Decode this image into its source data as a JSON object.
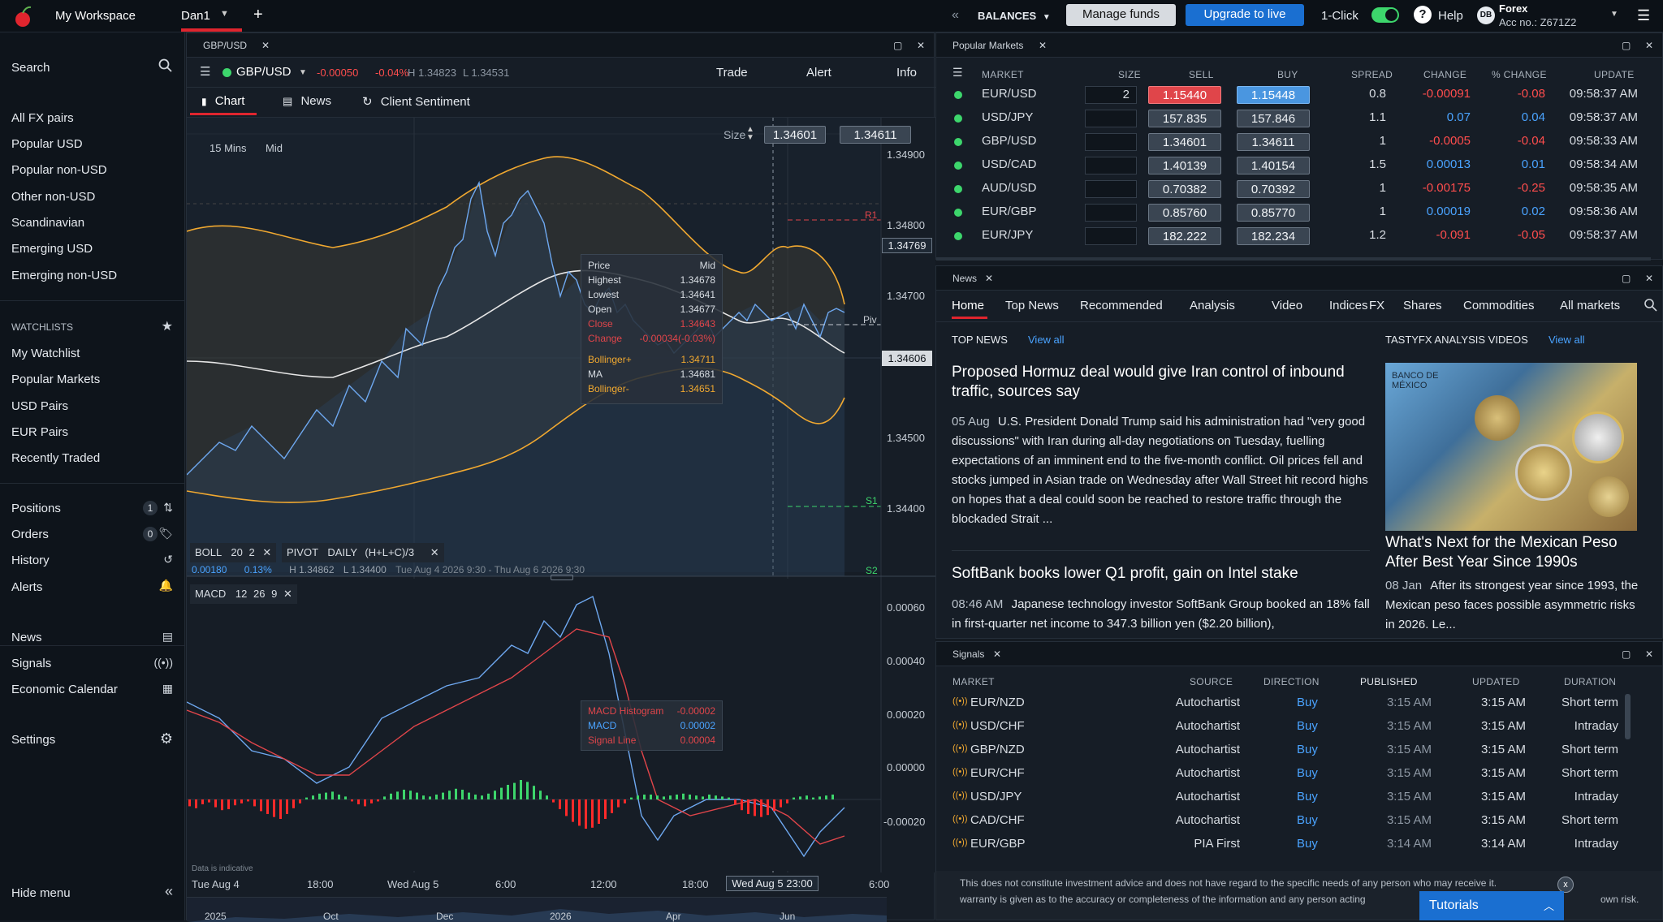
{
  "topbar": {
    "workspace": "My Workspace",
    "tab": "Dan1",
    "add": "+",
    "balances": "BALANCES",
    "manage_funds": "Manage funds",
    "upgrade": "Upgrade to live",
    "one_click": "1-Click",
    "help": "Help",
    "account_type": "Forex",
    "account_no": "Acc no.: Z671Z2",
    "avatar": "DB"
  },
  "sidebar": {
    "search": "Search",
    "pairs": [
      "All FX pairs",
      "Popular USD",
      "Popular non-USD",
      "Other non-USD",
      "Scandinavian",
      "Emerging USD",
      "Emerging non-USD"
    ],
    "watchlists_title": "WATCHLISTS",
    "watchlists": [
      "My Watchlist",
      "Popular Markets",
      "USD Pairs",
      "EUR Pairs",
      "Recently Traded"
    ],
    "positions": "Positions",
    "positions_count": "1",
    "orders": "Orders",
    "orders_count": "0",
    "history": "History",
    "alerts": "Alerts",
    "news": "News",
    "signals": "Signals",
    "economic_calendar": "Economic Calendar",
    "settings": "Settings",
    "hide_menu": "Hide menu"
  },
  "chart_panel": {
    "tab": "GBP/USD",
    "instrument": "GBP/USD",
    "change": "-0.00050",
    "change_pct": "-0.04%",
    "high": "H 1.34823",
    "low": "L 1.34531",
    "trade": "Trade",
    "alert": "Alert",
    "info": "Info",
    "subtabs": [
      "Chart",
      "News",
      "Client Sentiment"
    ],
    "interval": "15 Mins",
    "price_type": "Mid",
    "size_label": "Size",
    "sell": "1.34601",
    "buy": "1.34611",
    "price_axis": [
      "1.34900",
      "1.34800",
      "1.34769",
      "1.34700",
      "1.34606",
      "1.34500",
      "1.34400"
    ],
    "levels": {
      "r1": "R1",
      "piv": "Piv",
      "s1": "S1",
      "s2": "S2"
    },
    "tooltip": {
      "price": "Price",
      "mid": "Mid",
      "rows": [
        [
          "Highest",
          "1.34678"
        ],
        [
          "Lowest",
          "1.34641"
        ],
        [
          "Open",
          "1.34677"
        ],
        [
          "Close",
          "1.34643"
        ],
        [
          "Change",
          "-0.00034(-0.03%)"
        ]
      ],
      "bands": [
        [
          "Bollinger+",
          "1.34711"
        ],
        [
          "MA",
          "1.34681"
        ],
        [
          "Bollinger-",
          "1.34651"
        ]
      ]
    },
    "boll": {
      "name": "BOLL",
      "p1": "20",
      "p2": "2",
      "value": "0.00180",
      "pct": "0.13%",
      "high": "H 1.34862",
      "low": "L 1.34400",
      "range": "Tue Aug 4 2026 9:30 - Thu Aug 6 2026 9:30"
    },
    "pivot": {
      "name": "PIVOT",
      "type": "DAILY",
      "formula": "(H+L+C)/3"
    },
    "macd": {
      "name": "MACD",
      "p1": "12",
      "p2": "26",
      "p3": "9",
      "axis": [
        "0.00060",
        "0.00040",
        "0.00020",
        "0.00000",
        "-0.00020"
      ],
      "tooltip": [
        [
          "MACD Histogram",
          "-0.00002"
        ],
        [
          "MACD",
          "0.00002"
        ],
        [
          "Signal Line",
          "0.00004"
        ]
      ]
    },
    "disclaimer": "Data is indicative",
    "time_axis": [
      "Tue Aug 4",
      "18:00",
      "Wed Aug 5",
      "6:00",
      "12:00",
      "18:00",
      "6:00"
    ],
    "crosshair_time": "Wed Aug 5 23:00",
    "nav_axis": [
      "2025",
      "Oct",
      "Dec",
      "2026",
      "Apr",
      "Jun"
    ]
  },
  "popular_markets": {
    "tab": "Popular Markets",
    "headers": [
      "MARKET",
      "SIZE",
      "SELL",
      "BUY",
      "SPREAD",
      "CHANGE",
      "% CHANGE",
      "UPDATE"
    ],
    "rows": [
      {
        "market": "EUR/USD",
        "size": "2",
        "sell": "1.15440",
        "buy": "1.15448",
        "spread": "0.8",
        "change": "-0.00091",
        "pct": "-0.08",
        "time": "09:58:37 AM",
        "dir": "neg",
        "hl": true
      },
      {
        "market": "USD/JPY",
        "size": "",
        "sell": "157.835",
        "buy": "157.846",
        "spread": "1.1",
        "change": "0.07",
        "pct": "0.04",
        "time": "09:58:37 AM",
        "dir": "pos",
        "hl": false
      },
      {
        "market": "GBP/USD",
        "size": "",
        "sell": "1.34601",
        "buy": "1.34611",
        "spread": "1",
        "change": "-0.0005",
        "pct": "-0.04",
        "time": "09:58:33 AM",
        "dir": "neg",
        "hl": false
      },
      {
        "market": "USD/CAD",
        "size": "",
        "sell": "1.40139",
        "buy": "1.40154",
        "spread": "1.5",
        "change": "0.00013",
        "pct": "0.01",
        "time": "09:58:34 AM",
        "dir": "pos",
        "hl": false
      },
      {
        "market": "AUD/USD",
        "size": "",
        "sell": "0.70382",
        "buy": "0.70392",
        "spread": "1",
        "change": "-0.00175",
        "pct": "-0.25",
        "time": "09:58:35 AM",
        "dir": "neg",
        "hl": false
      },
      {
        "market": "EUR/GBP",
        "size": "",
        "sell": "0.85760",
        "buy": "0.85770",
        "spread": "1",
        "change": "0.00019",
        "pct": "0.02",
        "time": "09:58:36 AM",
        "dir": "pos",
        "hl": false
      },
      {
        "market": "EUR/JPY",
        "size": "",
        "sell": "182.222",
        "buy": "182.234",
        "spread": "1.2",
        "change": "-0.091",
        "pct": "-0.05",
        "time": "09:58:37 AM",
        "dir": "neg",
        "hl": false
      }
    ]
  },
  "news": {
    "tab": "News",
    "nav": [
      "Home",
      "Top News",
      "Recommended",
      "Analysis",
      "Video",
      "Indices",
      "FX",
      "Shares",
      "Commodities",
      "All markets"
    ],
    "top_news": "TOP NEWS",
    "view_all": "View all",
    "videos_title": "TASTYFX ANALYSIS VIDEOS",
    "videos_view_all": "View all",
    "story1_title": "Proposed Hormuz deal would give Iran control of inbound traffic, sources say",
    "story1_date": "05 Aug",
    "story1_body": "U.S. President Donald Trump said his administration had \"very good discussions\" with Iran during all-day negotiations on Tuesday, fuelling expectations of an imminent end to the five-month conflict. Oil prices fell and stocks jumped in Asian trade on Wednesday after Wall Street hit record highs on hopes that a deal could soon be reached to restore traffic through the blockaded Strait ...",
    "story2_title": "SoftBank books lower Q1 profit, gain on Intel stake",
    "story2_date": "08:46 AM",
    "story2_body": "Japanese technology investor SoftBank Group booked an 18% fall in first-quarter net income to 347.3 billion yen ($2.20 billion),",
    "video_title": "What's Next for the Mexican Peso After Best Year Since 1990s",
    "video_date": "08 Jan",
    "video_body": "After its strongest year since 1993, the Mexican peso faces possible asymmetric risks in 2026. Le...",
    "banknote_text": "BANCO DE MÉXICO"
  },
  "signals": {
    "tab": "Signals",
    "headers": [
      "MARKET",
      "SOURCE",
      "DIRECTION",
      "PUBLISHED",
      "UPDATED",
      "DURATION"
    ],
    "rows": [
      {
        "market": "EUR/NZD",
        "source": "Autochartist",
        "direction": "Buy",
        "published": "3:15 AM",
        "updated": "3:15 AM",
        "duration": "Short term"
      },
      {
        "market": "USD/CHF",
        "source": "Autochartist",
        "direction": "Buy",
        "published": "3:15 AM",
        "updated": "3:15 AM",
        "duration": "Intraday"
      },
      {
        "market": "GBP/NZD",
        "source": "Autochartist",
        "direction": "Buy",
        "published": "3:15 AM",
        "updated": "3:15 AM",
        "duration": "Short term"
      },
      {
        "market": "EUR/CHF",
        "source": "Autochartist",
        "direction": "Buy",
        "published": "3:15 AM",
        "updated": "3:15 AM",
        "duration": "Short term"
      },
      {
        "market": "USD/JPY",
        "source": "Autochartist",
        "direction": "Buy",
        "published": "3:15 AM",
        "updated": "3:15 AM",
        "duration": "Intraday"
      },
      {
        "market": "CAD/CHF",
        "source": "Autochartist",
        "direction": "Buy",
        "published": "3:15 AM",
        "updated": "3:15 AM",
        "duration": "Short term"
      },
      {
        "market": "EUR/GBP",
        "source": "PIA First",
        "direction": "Buy",
        "published": "3:14 AM",
        "updated": "3:14 AM",
        "duration": "Intraday"
      }
    ],
    "disclaimer_line1": "This does not constitute investment advice and does not have regard to the specific needs of any person who may receive it.",
    "disclaimer_line2": "warranty is given as to the accuracy or completeness of the information and any person acting",
    "disclaimer_tail": "own risk.",
    "tutorials": "Tutorials"
  },
  "colors": {
    "accent_red": "#e0252e",
    "upgrade_blue": "#1a6fd1",
    "green": "#3dd66c",
    "neg": "#ff4d4d",
    "pos": "#4aa3ff"
  }
}
